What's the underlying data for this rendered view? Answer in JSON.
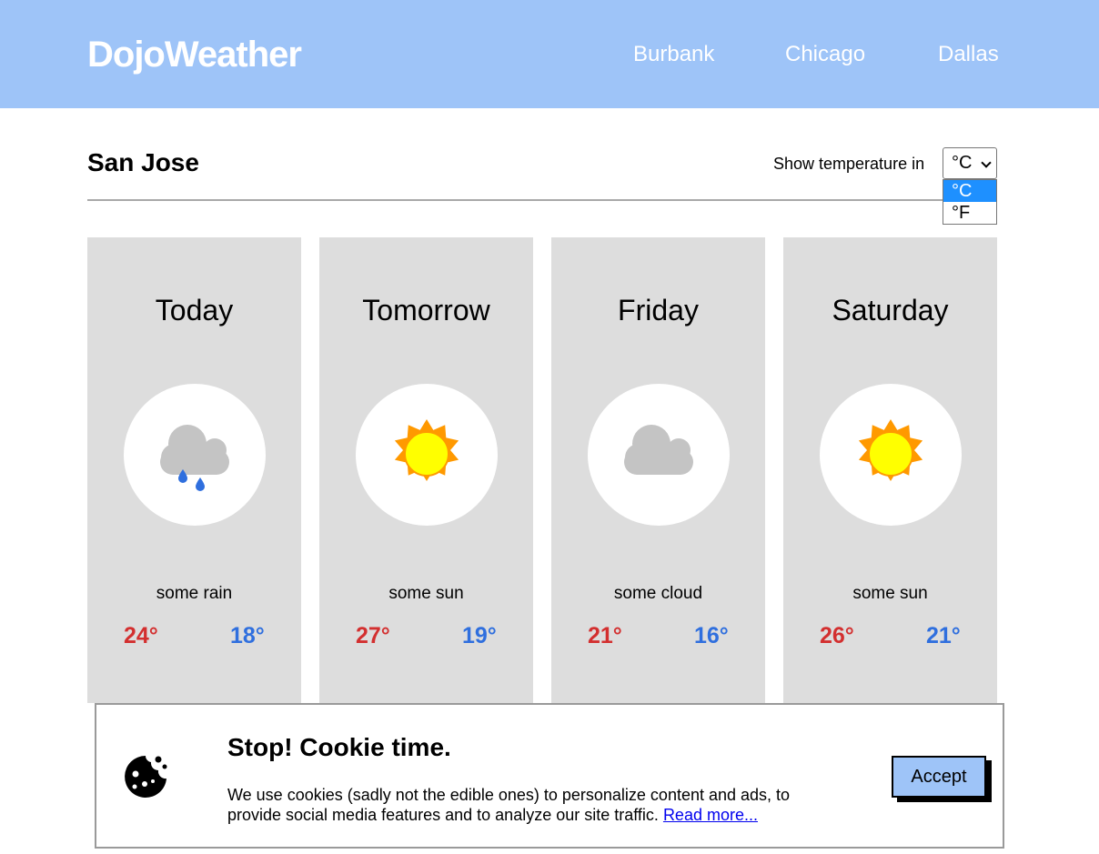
{
  "header": {
    "brand": "DojoWeather",
    "nav": [
      "Burbank",
      "Chicago",
      "Dallas"
    ]
  },
  "city": {
    "name": "San Jose",
    "unit_label": "Show temperature in",
    "unit_selected": "°C",
    "unit_options": [
      "°C",
      "°F"
    ]
  },
  "forecast": [
    {
      "day": "Today",
      "icon": "rain-cloud-icon",
      "desc": "some rain",
      "high": "24°",
      "low": "18°"
    },
    {
      "day": "Tomorrow",
      "icon": "sun-icon",
      "desc": "some sun",
      "high": "27°",
      "low": "19°"
    },
    {
      "day": "Friday",
      "icon": "cloud-icon",
      "desc": "some cloud",
      "high": "21°",
      "low": "16°"
    },
    {
      "day": "Saturday",
      "icon": "sun-icon",
      "desc": "some sun",
      "high": "26°",
      "low": "21°"
    }
  ],
  "cookie": {
    "title": "Stop! Cookie time.",
    "body": "We use cookies (sadly not the edible ones) to personalize content and ads, to provide social media features and to analyze our site traffic. ",
    "link": "Read more...",
    "accept": "Accept",
    "icon": "cookie-icon"
  },
  "colors": {
    "header_bg": "#9ec4f8",
    "card_bg": "#dddddd",
    "high_temp": "#d32f2f",
    "low_temp": "#2f6fde",
    "sun_fill": "#ffff00",
    "sun_rays": "#ff9900",
    "cloud": "#c4c4c4",
    "raindrop": "#2f6fde",
    "option_highlight": "#1e90ff"
  }
}
